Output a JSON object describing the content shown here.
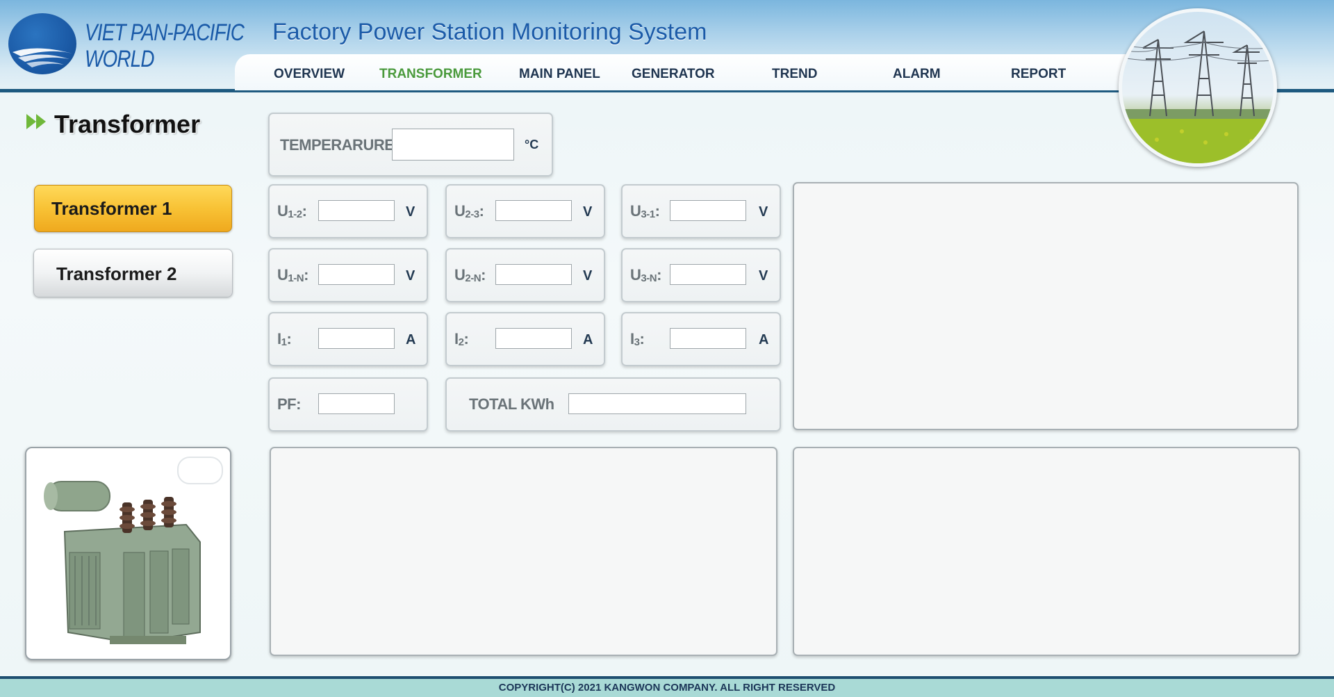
{
  "header": {
    "logo_line1": "VIET PAN-PACIFIC",
    "logo_line2": "WORLD",
    "app_title": "Factory Power Station Monitoring System"
  },
  "nav": {
    "items": [
      {
        "label": "OVERVIEW"
      },
      {
        "label": "TRANSFORMER"
      },
      {
        "label": "MAIN PANEL"
      },
      {
        "label": "GENERATOR"
      },
      {
        "label": "TREND"
      },
      {
        "label": "ALARM"
      },
      {
        "label": "REPORT"
      }
    ],
    "active": "TRANSFORMER"
  },
  "page": {
    "title": "Transformer",
    "title_icon": "double-chevron-right-icon"
  },
  "sidebar": {
    "buttons": [
      {
        "label": "Transformer 1",
        "selected": true
      },
      {
        "label": "Transformer 2",
        "selected": false
      }
    ]
  },
  "fields": {
    "temperature": {
      "label": "TEMPERARURE:",
      "unit": "°C",
      "value": ""
    },
    "u12": {
      "main": "U",
      "sub": "1-2",
      "colon": ":",
      "unit": "V",
      "value": ""
    },
    "u23": {
      "main": "U",
      "sub": "2-3",
      "colon": ":",
      "unit": "V",
      "value": ""
    },
    "u31": {
      "main": "U",
      "sub": "3-1",
      "colon": ":",
      "unit": "V",
      "value": ""
    },
    "u1n": {
      "main": "U",
      "sub": "1-N",
      "colon": ":",
      "unit": "V",
      "value": ""
    },
    "u2n": {
      "main": "U",
      "sub": "2-N",
      "colon": ":",
      "unit": "V",
      "value": ""
    },
    "u3n": {
      "main": "U",
      "sub": "3-N",
      "colon": ":",
      "unit": "V",
      "value": ""
    },
    "i1": {
      "main": "I",
      "sub": "1",
      "colon": ":",
      "unit": "A",
      "value": ""
    },
    "i2": {
      "main": "I",
      "sub": "2",
      "colon": ":",
      "unit": "A",
      "value": ""
    },
    "i3": {
      "main": "I",
      "sub": "3",
      "colon": ":",
      "unit": "A",
      "value": ""
    },
    "pf": {
      "label": "PF:",
      "value": ""
    },
    "total_kwh": {
      "label": "TOTAL KWh",
      "value": ""
    }
  },
  "footer": {
    "copyright": "COPYRIGHT(C) 2021 KANGWON COMPANY. ALL RIGHT RESERVED"
  },
  "colors": {
    "brand_blue": "#1a5aa8",
    "nav_active": "#4a9a3c",
    "selected_button": "#f8c235",
    "header_line": "#1e5a80",
    "footer_bg": "#a9dad6"
  }
}
